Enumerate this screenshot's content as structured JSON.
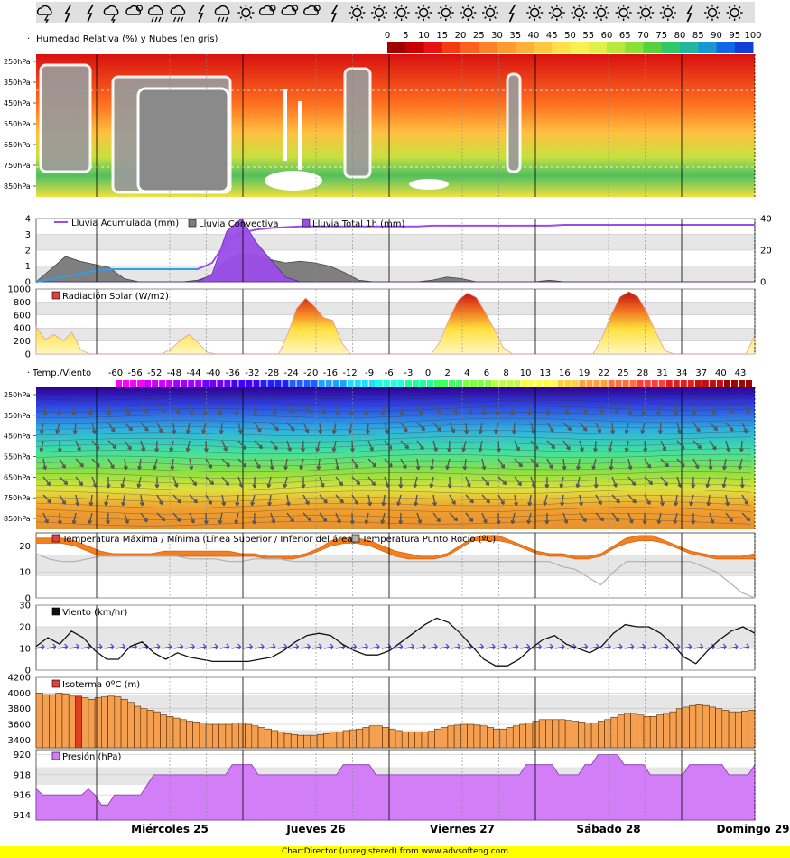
{
  "icon_strip": [
    "storm-cloud",
    "lightning",
    "lightning",
    "storm-cloud",
    "partly-cloudy",
    "rain-cloud",
    "rain-cloud",
    "lightning",
    "rain-cloud",
    "sun",
    "partly-cloudy",
    "partly-cloudy",
    "partly-cloudy",
    "lightning",
    "sun",
    "sun",
    "sun",
    "sun",
    "sun",
    "sun",
    "sun",
    "lightning",
    "sun",
    "sun",
    "sun",
    "sun",
    "sun",
    "sun",
    "sun",
    "lightning",
    "sun",
    "sun"
  ],
  "days": [
    "Miércoles 25",
    "Jueves 26",
    "Viernes 27",
    "Sábado 28",
    "Domingo 29"
  ],
  "footer": "ChartDirector (unregistered) from www.advsofteng.com",
  "colors": {
    "accent_purple": "#9a4de8",
    "rain_grey": "#7f7f7f",
    "temp_orange": "#f08020",
    "wind_arrow": "#4444dd",
    "iso_bar": "#f4a050",
    "pressure_fill": "#d27ef7",
    "band_grey": "#e6e6e6"
  },
  "chart_data": [
    {
      "type": "heatmap",
      "title": "Humedad Relativa (%) y Nubes (en gris)",
      "levels": [
        "250hPa",
        "350hPa",
        "450hPa",
        "550hPa",
        "650hPa",
        "750hPa",
        "850hPa"
      ],
      "colorbar": [
        "0",
        "5",
        "10",
        "15",
        "20",
        "25",
        "30",
        "35",
        "40",
        "45",
        "50",
        "55",
        "60",
        "65",
        "70",
        "75",
        "80",
        "85",
        "90",
        "95",
        "100"
      ],
      "palette": [
        "#a00000",
        "#c80000",
        "#e81010",
        "#f83a10",
        "#ff6020",
        "#ff8028",
        "#ff9a30",
        "#ffb038",
        "#ffc840",
        "#ffe048",
        "#f8f050",
        "#e0f048",
        "#b8e840",
        "#88e038",
        "#58d040",
        "#30c868",
        "#20b8a0",
        "#1898d0",
        "#1068e8",
        "#1040d8",
        "#1020a0"
      ]
    },
    {
      "type": "area",
      "series": [
        {
          "name": "Lluvia Acumulada (mm)",
          "values": [
            0,
            1.5,
            3.5,
            5,
            7,
            8,
            8,
            8,
            8,
            8,
            8,
            8,
            12,
            26,
            31,
            33,
            34,
            34.5,
            35,
            35,
            35,
            35,
            35,
            35,
            35,
            35,
            35,
            35.5,
            35.5,
            35.5,
            35.5,
            35.5,
            35.5,
            35.5,
            35.5,
            35.5,
            36,
            36,
            36,
            36,
            36,
            36,
            36,
            36,
            36,
            36,
            36,
            36,
            36,
            36
          ]
        },
        {
          "name": "Lluvia Convectiva",
          "values": [
            0,
            0.8,
            1.6,
            1.3,
            1.1,
            0.9,
            0.2,
            0,
            0,
            0,
            0,
            0.1,
            0.4,
            1.4,
            1.8,
            1.7,
            1.4,
            1.2,
            1.3,
            1.2,
            1.0,
            0.6,
            0.1,
            0,
            0,
            0,
            0,
            0.1,
            0.3,
            0.2,
            0,
            0,
            0,
            0,
            0,
            0.1,
            0,
            0,
            0,
            0,
            0,
            0,
            0,
            0,
            0,
            0,
            0,
            0,
            0,
            0
          ]
        },
        {
          "name": "Lluvia Total 1h (mm)",
          "values": [
            0,
            0,
            0,
            0,
            0,
            0,
            0,
            0,
            0,
            0,
            0,
            0,
            0.5,
            3.2,
            4.0,
            2.5,
            1.4,
            0.3,
            0,
            0,
            0,
            0,
            0,
            0,
            0,
            0,
            0,
            0,
            0,
            0,
            0,
            0,
            0,
            0,
            0,
            0,
            0,
            0,
            0,
            0,
            0,
            0,
            0,
            0,
            0,
            0,
            0,
            0,
            0,
            0
          ]
        }
      ],
      "ylim_left": [
        0,
        4
      ],
      "yticks_left": [
        "0",
        "1",
        "2",
        "3",
        "4"
      ],
      "ylim_right": [
        0,
        40
      ],
      "yticks_right": [
        "0",
        "20",
        "40"
      ]
    },
    {
      "type": "area",
      "title": "Radiación Solar (W/m2)",
      "values": [
        420,
        220,
        300,
        200,
        330,
        60,
        0,
        0,
        0,
        0,
        0,
        0,
        0,
        0,
        0,
        80,
        200,
        300,
        180,
        30,
        0,
        0,
        0,
        0,
        0,
        0,
        0,
        0,
        300,
        700,
        860,
        730,
        560,
        520,
        180,
        0,
        0,
        0,
        0,
        0,
        0,
        0,
        0,
        0,
        0,
        200,
        550,
        830,
        940,
        870,
        640,
        380,
        100,
        0,
        0,
        0,
        0,
        0,
        0,
        0,
        0,
        0,
        0,
        250,
        600,
        880,
        960,
        880,
        640,
        330,
        50,
        0,
        0,
        0,
        0,
        0,
        0,
        0,
        0,
        0,
        280
      ],
      "ylim": [
        0,
        1000
      ],
      "yticks": [
        "0",
        "200",
        "400",
        "600",
        "800",
        "1000"
      ]
    },
    {
      "type": "heatmap",
      "title": "Temp./Viento",
      "levels": [
        "250hPa",
        "350hPa",
        "450hPa",
        "550hPa",
        "650hPa",
        "750hPa",
        "850hPa"
      ],
      "colorbar": [
        "-60",
        "-56",
        "-52",
        "-48",
        "-44",
        "-40",
        "-36",
        "-32",
        "-28",
        "-24",
        "-20",
        "-16",
        "-12",
        "-9",
        "-6",
        "-3",
        "0",
        "2",
        "4",
        "6",
        "8",
        "10",
        "13",
        "16",
        "19",
        "22",
        "25",
        "28",
        "31",
        "34",
        "37",
        "40",
        "43"
      ]
    },
    {
      "type": "line",
      "series": [
        {
          "name": "Temperatura Máxima / Mínima (Línea Superior / Inferior del área)",
          "upper": [
            23,
            23,
            23,
            22,
            20,
            18,
            17,
            17,
            17,
            17,
            18,
            18,
            18,
            18,
            18,
            18,
            17,
            17,
            16,
            16,
            16,
            17,
            19,
            22,
            23,
            23,
            22,
            20,
            18,
            17,
            16,
            16,
            17,
            20,
            23,
            24,
            24,
            22,
            20,
            18,
            17,
            17,
            16,
            16,
            17,
            20,
            23,
            24,
            24,
            22,
            20,
            18,
            17,
            16,
            16,
            16,
            17
          ],
          "lower": [
            21,
            21,
            21,
            20,
            18,
            16,
            16,
            16,
            16,
            16,
            16,
            16,
            16,
            16,
            16,
            16,
            16,
            16,
            15,
            15,
            15,
            16,
            18,
            20,
            21,
            21,
            20,
            18,
            16,
            15,
            15,
            15,
            16,
            19,
            22,
            22,
            22,
            21,
            19,
            17,
            16,
            16,
            15,
            15,
            16,
            19,
            21,
            22,
            22,
            21,
            19,
            17,
            16,
            15,
            15,
            15,
            15
          ]
        },
        {
          "name": "Temperatura Punto Rocío (ºC)",
          "values": [
            17,
            15,
            14,
            14,
            15,
            16,
            16,
            16,
            16,
            16,
            16,
            16,
            15,
            15,
            15,
            14,
            14,
            15,
            15,
            15,
            14,
            14,
            14,
            14,
            14,
            14,
            14,
            14,
            14,
            14,
            14,
            14,
            14,
            14,
            14,
            14,
            14,
            14,
            14,
            14,
            14,
            12,
            11,
            8,
            5,
            10,
            14,
            14,
            14,
            14,
            14,
            14,
            12,
            10,
            6,
            2,
            0
          ]
        }
      ],
      "ylim": [
        0,
        25
      ],
      "yticks": [
        "0",
        "10",
        "20"
      ]
    },
    {
      "type": "line",
      "title": "Viento (km/hr)",
      "values": [
        11,
        15,
        12,
        18,
        15,
        9,
        5,
        5,
        11,
        13,
        8,
        5,
        8,
        6,
        5,
        4,
        4,
        4,
        4,
        5,
        6,
        9,
        13,
        16,
        17,
        16,
        12,
        9,
        7,
        7,
        9,
        13,
        17,
        21,
        24,
        22,
        17,
        11,
        5,
        2,
        2,
        5,
        10,
        14,
        16,
        12,
        10,
        8,
        11,
        17,
        21,
        20,
        20,
        17,
        12,
        6,
        3,
        9,
        14,
        18,
        20,
        17
      ],
      "ylim": [
        0,
        30
      ],
      "yticks": [
        "0",
        "10",
        "20",
        "30"
      ]
    },
    {
      "type": "bar",
      "title": "Isoterma 0ºC (m)",
      "values": [
        4000,
        3980,
        3980,
        4000,
        3990,
        3960,
        3960,
        3940,
        3920,
        3940,
        3950,
        3960,
        3950,
        3920,
        3880,
        3830,
        3800,
        3780,
        3760,
        3720,
        3700,
        3680,
        3660,
        3640,
        3630,
        3620,
        3600,
        3600,
        3600,
        3600,
        3620,
        3620,
        3600,
        3580,
        3560,
        3540,
        3520,
        3500,
        3480,
        3470,
        3460,
        3460,
        3460,
        3470,
        3480,
        3500,
        3500,
        3520,
        3530,
        3540,
        3560,
        3580,
        3580,
        3560,
        3540,
        3520,
        3500,
        3500,
        3500,
        3500,
        3510,
        3540,
        3560,
        3580,
        3590,
        3600,
        3600,
        3590,
        3580,
        3560,
        3540,
        3540,
        3560,
        3580,
        3600,
        3620,
        3640,
        3660,
        3660,
        3660,
        3660,
        3650,
        3640,
        3630,
        3620,
        3620,
        3640,
        3660,
        3690,
        3720,
        3740,
        3740,
        3720,
        3700,
        3700,
        3720,
        3740,
        3760,
        3800,
        3820,
        3840,
        3850,
        3840,
        3820,
        3800,
        3780,
        3760,
        3760,
        3770,
        3780
      ],
      "ylim": [
        3300,
        4200
      ],
      "yticks": [
        "3400",
        "3600",
        "3800",
        "4000",
        "4200"
      ]
    },
    {
      "type": "area",
      "title": "Presión (hPa)",
      "values": [
        916.6,
        916,
        916,
        916,
        916,
        916,
        916,
        916,
        916.6,
        916,
        915,
        915,
        916,
        916,
        916,
        916,
        916,
        917,
        918,
        918,
        918,
        918,
        918,
        918,
        918,
        918,
        918,
        918,
        918,
        918,
        919,
        919,
        919,
        919,
        918,
        918,
        918,
        918,
        918,
        918,
        918,
        918,
        918,
        918,
        918,
        918,
        918,
        919,
        919,
        919,
        919,
        919,
        918,
        918,
        918,
        918,
        918,
        918,
        918,
        918,
        918,
        918,
        918,
        918,
        918,
        918,
        918,
        918,
        918,
        918,
        918,
        918,
        918,
        918,
        918,
        919,
        919,
        919,
        919,
        919,
        918,
        918,
        918,
        918,
        919,
        919,
        920,
        920,
        920,
        920,
        919,
        919,
        919,
        919,
        918,
        918,
        918,
        918,
        918,
        918,
        919,
        919,
        919,
        919,
        919,
        919,
        918,
        918,
        918,
        918,
        919
      ],
      "ylim": [
        913.5,
        920.5
      ],
      "yticks": [
        "914",
        "916",
        "918",
        "920"
      ]
    }
  ]
}
